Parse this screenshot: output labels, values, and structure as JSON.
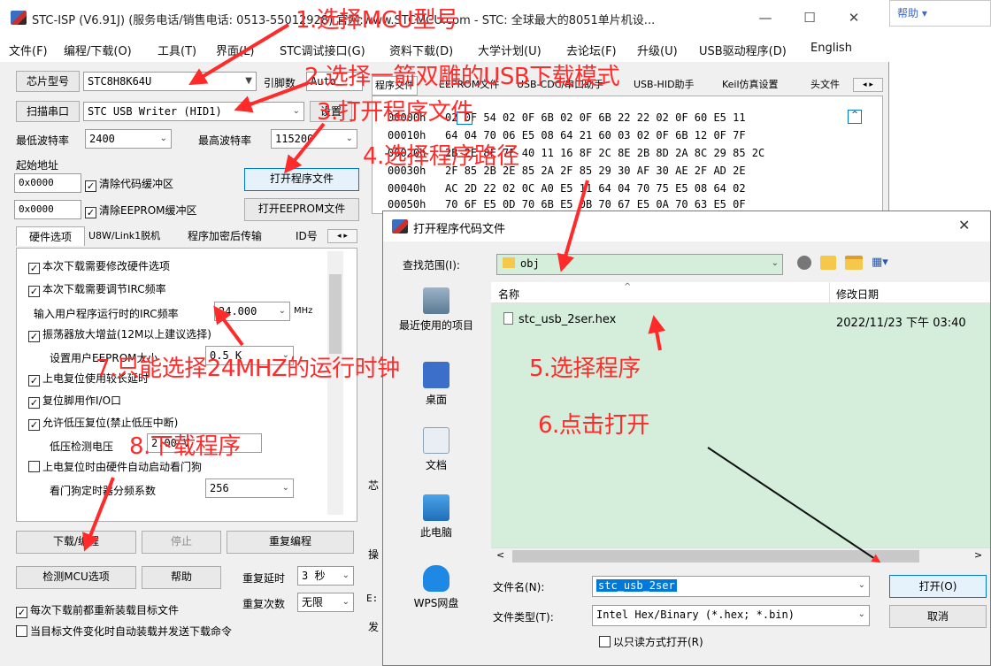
{
  "window": {
    "title": "STC-ISP (V6.91J) (服务电话/销售电话: 0513-55012928) 官网:www.STCMCU.com  - STC: 全球最大的8051单片机设...",
    "minimize": "—",
    "maximize": "☐",
    "close": "✕"
  },
  "right_strip": {
    "text": "帮助 ▾"
  },
  "menu": [
    "文件(F)",
    "编程/下载(O)",
    "工具(T)",
    "界面(L)",
    "STC调试接口(G)",
    "资料下载(D)",
    "大学计划(U)",
    "去论坛(F)",
    "升级(U)",
    "USB驱动程序(D)",
    "English"
  ],
  "left": {
    "chip_button": "芯片型号",
    "chip_value": "STC8H8K64U",
    "pins_label": "引脚数",
    "pins_value": "Auto",
    "scan_button": "扫描串口",
    "port_value": "STC USB Writer (HID1)",
    "settings_button": "设置",
    "min_baud_label": "最低波特率",
    "min_baud_value": "2400",
    "max_baud_label": "最高波特率",
    "max_baud_value": "115200",
    "start_addr_label": "起始地址",
    "addr1": "0x0000",
    "clear_code": "清除代码缓冲区",
    "open_program": "打开程序文件",
    "addr2": "0x0000",
    "clear_eeprom": "清除EEPROM缓冲区",
    "open_eeprom": "打开EEPROM文件",
    "tabs": [
      "硬件选项",
      "U8W/Link1脱机",
      "程序加密后传输",
      "ID号"
    ],
    "options": {
      "opt1": "本次下载需要修改硬件选项",
      "opt2": "本次下载需要调节IRC频率",
      "irc_label": "输入用户程序运行时的IRC频率",
      "irc_value": "24.000",
      "irc_unit": "MHz",
      "opt3": "振荡器放大增益(12M以上建议选择)",
      "eeprom_label": "设置用户EEPROM大小",
      "eeprom_value": "0.5 K",
      "opt4": "上电复位使用较长延时",
      "opt5": "复位脚用作I/O口",
      "opt6": "允许低压复位(禁止低压中断)",
      "lv_label": "低压检测电压",
      "lv_value": "2.00 V",
      "opt7": "上电复位时由硬件自动启动看门狗",
      "wdt_label": "看门狗定时器分频系数",
      "wdt_value": "256"
    },
    "download_button": "下载/编程",
    "stop_button": "停止",
    "reprogram_button": "重复编程",
    "check_button": "检测MCU选项",
    "help_button": "帮助",
    "repeat_delay_label": "重复延时",
    "repeat_delay_value": "3 秒",
    "repeat_count_label": "重复次数",
    "repeat_count_value": "无限",
    "reload_each": "每次下载前都重新装载目标文件",
    "auto_reload": "当目标文件变化时自动装载并发送下载命令"
  },
  "right": {
    "tabs": [
      "程序文件",
      "EEPROM文件",
      "USB-CDC/串口助手",
      "USB-HID助手",
      "Keil仿真设置",
      "头文件"
    ],
    "hex_lines": [
      "00000h   02 0F 54 02 0F 6B 02 0F 6B 22 22 02 0F 60 E5 11",
      "00010h   64 04 70 06 E5 08 64 21 60 03 02 0F 6B 12 0F 7F",
      "00020h   2B 2E 8F 7F 40 11 16 8F 2C 8E 2B 8D 2A 8C 29 85 2C",
      "00030h   2F 85 2B 2E 85 2A 2F 85 29 30 AF 30 AE 2F AD 2E",
      "00040h   AC 2D 22 02 0C A0 E5 11 64 04 70 75 E5 08 64 02",
      "00050h   70 6F E5 0D 70 6B E5 0B 70 67 E5 0A 70 63 E5 0F"
    ],
    "side_labels": [
      "芯",
      "操",
      "E:",
      "发"
    ]
  },
  "dialog": {
    "title": "打开程序代码文件",
    "close": "✕",
    "lookin_label": "查找范围(I):",
    "lookin_value": "obj",
    "places": [
      "最近使用的项目",
      "桌面",
      "文档",
      "此电脑",
      "WPS网盘"
    ],
    "col_name": "名称",
    "col_date": "修改日期",
    "file_name": "stc_usb_2ser.hex",
    "file_date": "2022/11/23 下午 03:40",
    "filename_label": "文件名(N):",
    "filename_value": "stc_usb_2ser",
    "filetype_label": "文件类型(T):",
    "filetype_value": "Intel Hex/Binary (*.hex; *.bin)",
    "readonly_label": "以只读方式打开(R)",
    "open_button": "打开(O)",
    "cancel_button": "取消"
  },
  "annotations": {
    "a1": "1.选择MCU型号",
    "a2": "2.选择一箭双雕的USB下载模式",
    "a3": "3.打开程序文件",
    "a4": "4.选择程序路径",
    "a5": "5.选择程序",
    "a6": "6.点击打开",
    "a7": "7.只能选择24MHZ的运行时钟",
    "a8": "8.下载程序"
  },
  "colors": {
    "annotation": "#ff2b2b",
    "dialog_file_area": "#d4eedb",
    "selection_blue": "#0078d7"
  }
}
